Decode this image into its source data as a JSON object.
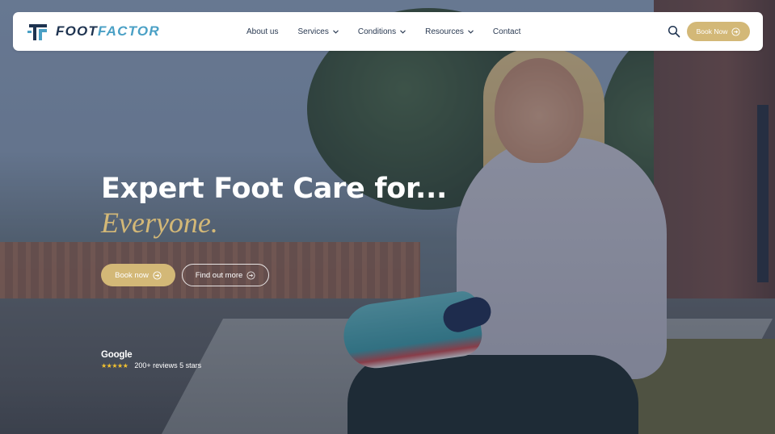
{
  "brand": {
    "logo_part1": "FOOT",
    "logo_part2": "FACTOR",
    "primary_color": "#1e3350",
    "accent_color": "#4aa0c5",
    "gold_color": "#d3b877"
  },
  "nav": {
    "items": [
      {
        "label": "About us",
        "has_dropdown": false
      },
      {
        "label": "Services",
        "has_dropdown": true
      },
      {
        "label": "Conditions",
        "has_dropdown": true
      },
      {
        "label": "Resources",
        "has_dropdown": true
      },
      {
        "label": "Contact",
        "has_dropdown": false
      }
    ],
    "search_icon": "search-icon",
    "book_label": "Book Now"
  },
  "hero": {
    "headline": "Expert Foot Care for...",
    "subheadline": "Everyone.",
    "primary_cta": "Book now",
    "secondary_cta": "Find out more",
    "reviews_brand": "Google",
    "stars": "★★★★★",
    "reviews_text": "200+ reviews 5 stars"
  }
}
